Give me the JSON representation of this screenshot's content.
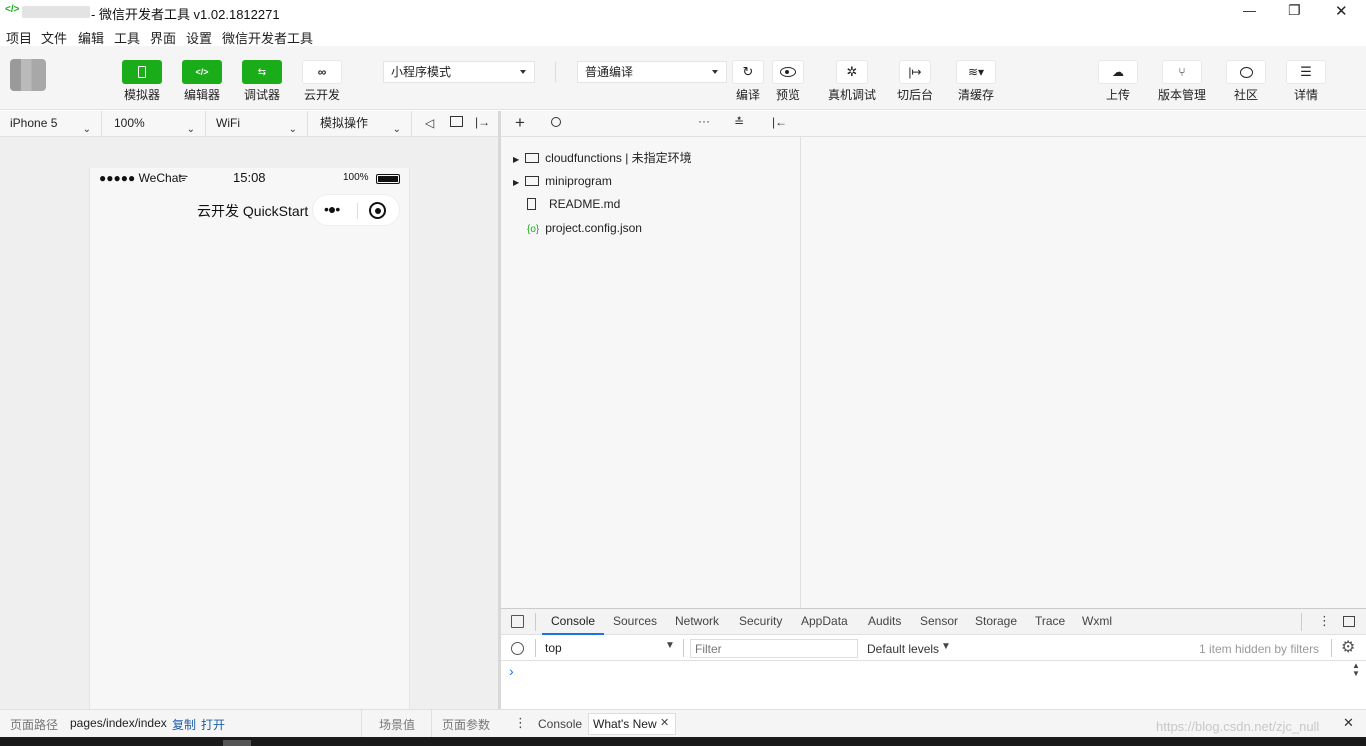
{
  "window": {
    "title": "- 微信开发者工具 v1.02.1812271",
    "controls": {
      "minimize": "—",
      "restore": "❐",
      "close": "✕"
    }
  },
  "menu": [
    "项目",
    "文件",
    "编辑",
    "工具",
    "界面",
    "设置",
    "微信开发者工具"
  ],
  "toolbar": {
    "left_buttons": [
      {
        "label": "模拟器",
        "icon": "phone-icon",
        "active": true
      },
      {
        "label": "编辑器",
        "icon": "code-icon",
        "active": true
      },
      {
        "label": "调试器",
        "icon": "debug-icon",
        "active": true
      },
      {
        "label": "云开发",
        "icon": "cloud-link-icon",
        "active": false
      }
    ],
    "mode_select": "小程序模式",
    "compile_select": "普通编译",
    "mid_buttons": [
      {
        "label": "编译",
        "icon": "refresh-icon"
      },
      {
        "label": "预览",
        "icon": "eye-icon"
      },
      {
        "label": "真机调试",
        "icon": "bug-icon"
      },
      {
        "label": "切后台",
        "icon": "switch-background-icon"
      },
      {
        "label": "清缓存",
        "icon": "layers-icon"
      }
    ],
    "right_buttons": [
      {
        "label": "上传",
        "icon": "cloud-upload-icon"
      },
      {
        "label": "版本管理",
        "icon": "branch-icon"
      },
      {
        "label": "社区",
        "icon": "chat-icon"
      },
      {
        "label": "详情",
        "icon": "menu-icon"
      }
    ]
  },
  "simulator_bar": {
    "device": "iPhone 5",
    "zoom": "100%",
    "network": "WiFi",
    "operation": "模拟操作"
  },
  "phone": {
    "carrier": "●●●●● WeChat",
    "time": "15:08",
    "battery": "100%",
    "nav_title": "云开发 QuickStart",
    "capsule_more": "•●•"
  },
  "file_tree": [
    {
      "name": "cloudfunctions | 未指定环境",
      "type": "cloud-folder",
      "expandable": true
    },
    {
      "name": "miniprogram",
      "type": "folder",
      "expandable": true
    },
    {
      "name": "README.md",
      "type": "file",
      "expandable": false
    },
    {
      "name": "project.config.json",
      "type": "json",
      "expandable": false
    }
  ],
  "devtools": {
    "tabs": [
      "Console",
      "Sources",
      "Network",
      "Security",
      "AppData",
      "Audits",
      "Sensor",
      "Storage",
      "Trace",
      "Wxml"
    ],
    "active_tab": "Console",
    "context": "top",
    "filter_placeholder": "Filter",
    "levels": "Default levels",
    "hidden_note": "1 item hidden by filters",
    "prompt": "›",
    "drawer_tabs": [
      "Console",
      "What's New"
    ]
  },
  "statusbar": {
    "path_label": "页面路径",
    "path": "pages/index/index",
    "copy": "复制",
    "open": "打开",
    "scene": "场景值",
    "params": "页面参数"
  },
  "watermark": "https://blog.csdn.net/zjc_null",
  "colors": {
    "brand_green": "#1aad19",
    "link_blue": "#1f5fa7",
    "active_tab_blue": "#1a73e8"
  }
}
